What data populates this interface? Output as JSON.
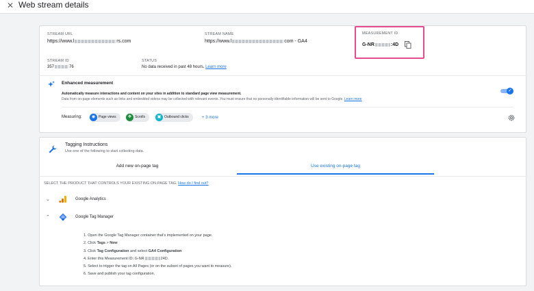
{
  "header": {
    "close_glyph": "✕",
    "title": "Web stream details"
  },
  "stream": {
    "url_label": "STREAM URL",
    "url_prefix": "https://www.l",
    "url_suffix": "rs.com",
    "name_label": "STREAM NAME",
    "name_prefix": "https://www.l",
    "name_suffix": "com - GA4",
    "measurement_label": "MEASUREMENT ID",
    "measurement_prefix": "G-NR",
    "measurement_suffix": ":4D",
    "id_label": "STREAM ID",
    "id_prefix": "357",
    "id_suffix": "76",
    "status_label": "STATUS",
    "status_text": "No data received in past 48 hours.",
    "status_link": "Learn more"
  },
  "enhanced": {
    "title": "Enhanced measurement",
    "desc_line1": "Automatically measure interactions and content on your sites in addition to standard page view measurement.",
    "desc_line2": "Data from on-page elements such as links and embedded videos may be collected with relevant events. You must ensure that no personally-identifiable information will be sent to Google.",
    "desc_link": "Learn more",
    "toggle_on": true,
    "measuring_label": "Measuring:",
    "chips": [
      {
        "label": "Page views",
        "color": "#1a73e8",
        "icon": "eye-icon"
      },
      {
        "label": "Scrolls",
        "color": "#1e8e3e",
        "icon": "crosshair-icon"
      },
      {
        "label": "Outbound clicks",
        "color": "#12b5cb",
        "icon": "lock-icon"
      }
    ],
    "more_link": "+ 3 more"
  },
  "tagging": {
    "title": "Tagging Instructions",
    "subtitle": "Use one of the following to start collecting data.",
    "tabs": [
      "Add new on-page tag",
      "Use existing on-page tag"
    ],
    "active_tab": 1,
    "select_prompt": "SELECT THE PRODUCT THAT CONTROLS YOUR EXISTING ON-PAGE TAG.",
    "select_link": "How do I find out?",
    "products": [
      {
        "name": "Google Analytics",
        "expanded": false,
        "chevron": "⌄"
      },
      {
        "name": "Google Tag Manager",
        "expanded": true,
        "chevron": "⌃"
      }
    ],
    "steps": {
      "s1": "1. Open the Google Tag Manager container that's implemented on your page.",
      "s2_a": "2. Click ",
      "s2_b": "Tags",
      "s2_c": " > ",
      "s2_d": "New",
      "s3_a": "3. Click ",
      "s3_b": "Tag Configuration",
      "s3_c": " and select ",
      "s3_d": "GA4 Configuration",
      "s4_a": "4. Enter this Measurement ID: G-NR",
      "s4_b": "24D.",
      "s5": "5. Select to trigger the tag on All Pages (or on the subset of pages you want to measure).",
      "s6": "6. Save and publish your tag configuration."
    }
  },
  "colors": {
    "accent": "#1a73e8",
    "highlight": "#e64a8d"
  }
}
